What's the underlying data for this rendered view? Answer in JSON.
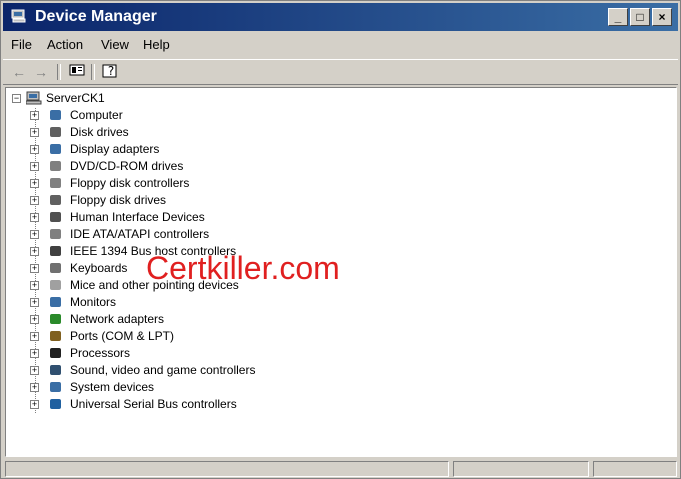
{
  "window": {
    "title": "Device Manager"
  },
  "title_buttons": {
    "minimize": "_",
    "maximize": "□",
    "close": "×"
  },
  "menu": {
    "items": [
      "File",
      "Action",
      "View",
      "Help"
    ]
  },
  "toolbar": {
    "buttons": [
      "back-icon",
      "forward-icon",
      "properties-icon",
      "help-icon"
    ]
  },
  "tree": {
    "root": "ServerCK1",
    "items": [
      {
        "label": "Computer",
        "icon": "computer-icon"
      },
      {
        "label": "Disk drives",
        "icon": "disk-drive-icon"
      },
      {
        "label": "Display adapters",
        "icon": "display-adapter-icon"
      },
      {
        "label": "DVD/CD-ROM drives",
        "icon": "dvd-drive-icon"
      },
      {
        "label": "Floppy disk controllers",
        "icon": "floppy-controller-icon"
      },
      {
        "label": "Floppy disk drives",
        "icon": "floppy-drive-icon"
      },
      {
        "label": "Human Interface Devices",
        "icon": "hid-icon"
      },
      {
        "label": "IDE ATA/ATAPI controllers",
        "icon": "ide-controller-icon"
      },
      {
        "label": "IEEE 1394 Bus host controllers",
        "icon": "ieee1394-icon"
      },
      {
        "label": "Keyboards",
        "icon": "keyboard-icon"
      },
      {
        "label": "Mice and other pointing devices",
        "icon": "mouse-icon"
      },
      {
        "label": "Monitors",
        "icon": "monitor-icon"
      },
      {
        "label": "Network adapters",
        "icon": "network-adapter-icon"
      },
      {
        "label": "Ports (COM & LPT)",
        "icon": "port-icon"
      },
      {
        "label": "Processors",
        "icon": "processor-icon"
      },
      {
        "label": "Sound, video and game controllers",
        "icon": "sound-icon"
      },
      {
        "label": "System devices",
        "icon": "system-device-icon"
      },
      {
        "label": "Universal Serial Bus controllers",
        "icon": "usb-icon"
      }
    ]
  },
  "watermark": "Certkiller.com"
}
